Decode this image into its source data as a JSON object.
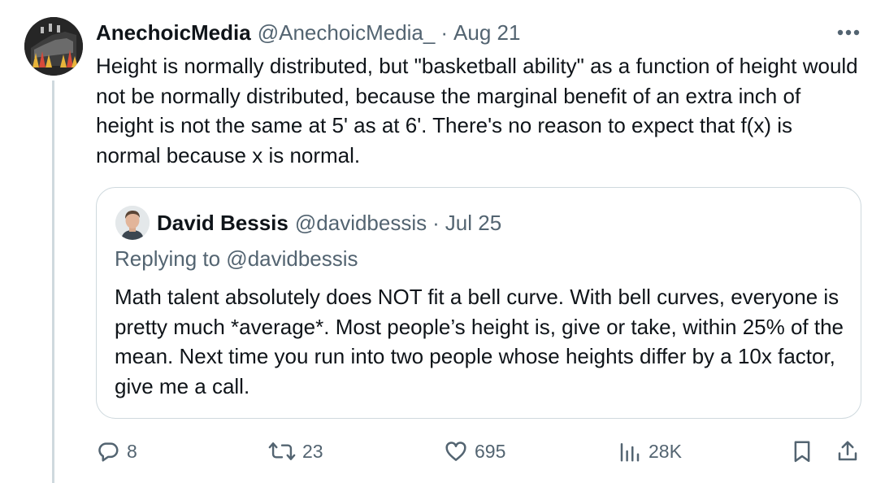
{
  "tweet": {
    "author_name": "AnechoicMedia",
    "author_handle": "@AnechoicMedia_",
    "separator": "·",
    "date": "Aug 21",
    "text": "Height is normally distributed, but \"basketball ability\" as a function of height would not be normally distributed, because the marginal benefit of an extra inch of height is not the same at 5' as at 6'. There's no reason to expect that f(x) is normal because x is normal."
  },
  "quoted": {
    "author_name": "David Bessis",
    "author_handle": "@davidbessis",
    "separator": "·",
    "date": "Jul 25",
    "replying_to": "Replying to @davidbessis",
    "text": "Math talent absolutely does NOT fit a bell curve. With bell curves, everyone is pretty much *average*. Most people’s height is, give or take, within 25% of the mean. Next time you run into two people whose heights differ by a 10x factor, give me a call."
  },
  "actions": {
    "replies": "8",
    "reposts": "23",
    "likes": "695",
    "views": "28K"
  },
  "icons": {
    "more": "more-horizontal-icon",
    "reply": "reply-bubble-icon",
    "repost": "repost-arrows-icon",
    "like": "heart-icon",
    "views": "analytics-bars-icon",
    "bookmark": "bookmark-icon",
    "share": "share-upload-icon"
  },
  "colors": {
    "text_primary": "#0f1419",
    "text_secondary": "#536471",
    "border": "#cfd9de"
  }
}
